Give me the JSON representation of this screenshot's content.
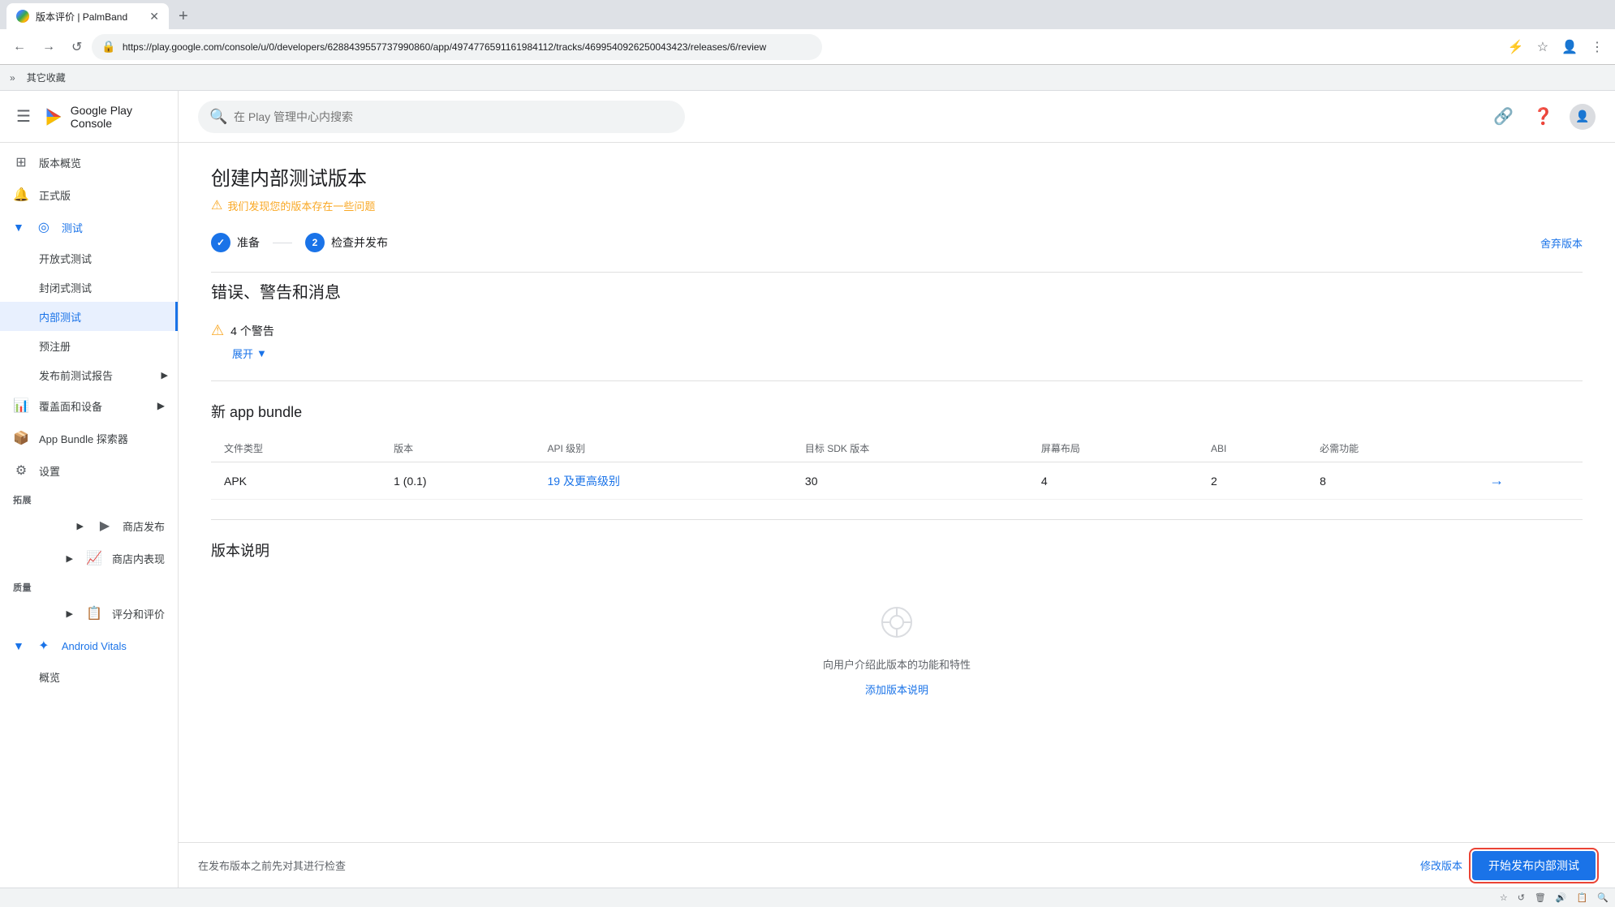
{
  "browser": {
    "tab_title": "版本评价 | PalmBand",
    "url": "https://play.google.com/console/u/0/developers/6288439557737990860/app/4974776591161984112/tracks/4699540926250043423/releases/6/review",
    "search_placeholder": "在 Play 管理中心内搜索",
    "bookmarks": [
      "其它收藏"
    ]
  },
  "sidebar": {
    "logo_text": "Google Play Console",
    "items": [
      {
        "id": "overview",
        "label": "版本概览",
        "icon": "⊞",
        "active": false
      },
      {
        "id": "release",
        "label": "正式版",
        "icon": "🔔",
        "active": false
      },
      {
        "id": "testing",
        "label": "测试",
        "icon": "◎",
        "active": false,
        "expanded": true
      },
      {
        "id": "open-testing",
        "label": "开放式测试",
        "sub": true,
        "active": false
      },
      {
        "id": "closed-testing",
        "label": "封闭式测试",
        "sub": true,
        "active": false
      },
      {
        "id": "internal-testing",
        "label": "内部测试",
        "sub": true,
        "active": true
      },
      {
        "id": "pre-register",
        "label": "预注册",
        "sub": true,
        "active": false
      },
      {
        "id": "pre-launch-report",
        "label": "发布前测试报告",
        "sub": true,
        "active": false,
        "expandable": true
      },
      {
        "id": "coverage",
        "label": "覆盖面和设备",
        "icon": "📊",
        "active": false,
        "expandable": true
      },
      {
        "id": "app-bundle",
        "label": "App Bundle 探索器",
        "icon": "📦",
        "active": false
      },
      {
        "id": "settings",
        "label": "设置",
        "icon": "⚙",
        "active": false
      },
      {
        "id": "expand-section",
        "label": "拓展",
        "section": true
      },
      {
        "id": "shop-publish",
        "label": "商店发布",
        "icon": "▶",
        "active": false,
        "expandable": true
      },
      {
        "id": "shop-performance",
        "label": "商店内表现",
        "icon": "📈",
        "active": false,
        "expandable": true
      },
      {
        "id": "quality-section",
        "label": "质量",
        "section": true
      },
      {
        "id": "ratings",
        "label": "评分和评价",
        "icon": "📋",
        "active": false,
        "expandable": true
      },
      {
        "id": "android-vitals",
        "label": "Android Vitals",
        "icon": "✦",
        "active": false,
        "expanded": true
      },
      {
        "id": "vitals-overview",
        "label": "概览",
        "sub": true,
        "active": false
      }
    ]
  },
  "main": {
    "page_title": "创建内部测试版本",
    "page_warning": "我们发现您的版本存在一些问题",
    "steps": [
      {
        "number": "✓",
        "label": "准备",
        "done": true
      },
      {
        "number": "2",
        "label": "检查并发布",
        "active": true
      }
    ],
    "step_divider": "—",
    "abandon_label": "舍弃版本",
    "errors_section_title": "错误、警告和消息",
    "warnings_count": "4 个警告",
    "expand_label": "展开",
    "bundle_section_title": "新 app bundle",
    "table_headers": [
      "文件类型",
      "版本",
      "API 级别",
      "目标 SDK 版本",
      "屏幕布局",
      "ABI",
      "必需功能"
    ],
    "table_rows": [
      {
        "file_type": "APK",
        "version": "1 (0.1)",
        "api_level": "19 及更高级别",
        "target_sdk": "30",
        "screen_layout": "4",
        "abi": "2",
        "required_features": "8"
      }
    ],
    "version_notes_title": "版本说明",
    "empty_state_icon": "◎",
    "empty_state_desc": "向用户介绍此版本的功能和特性",
    "add_notes_link": "添加版本说明",
    "bottom_bar_text": "在发布版本之前先对其进行检查",
    "modify_btn_label": "修改版本",
    "publish_btn_label": "开始发布内部测试"
  }
}
